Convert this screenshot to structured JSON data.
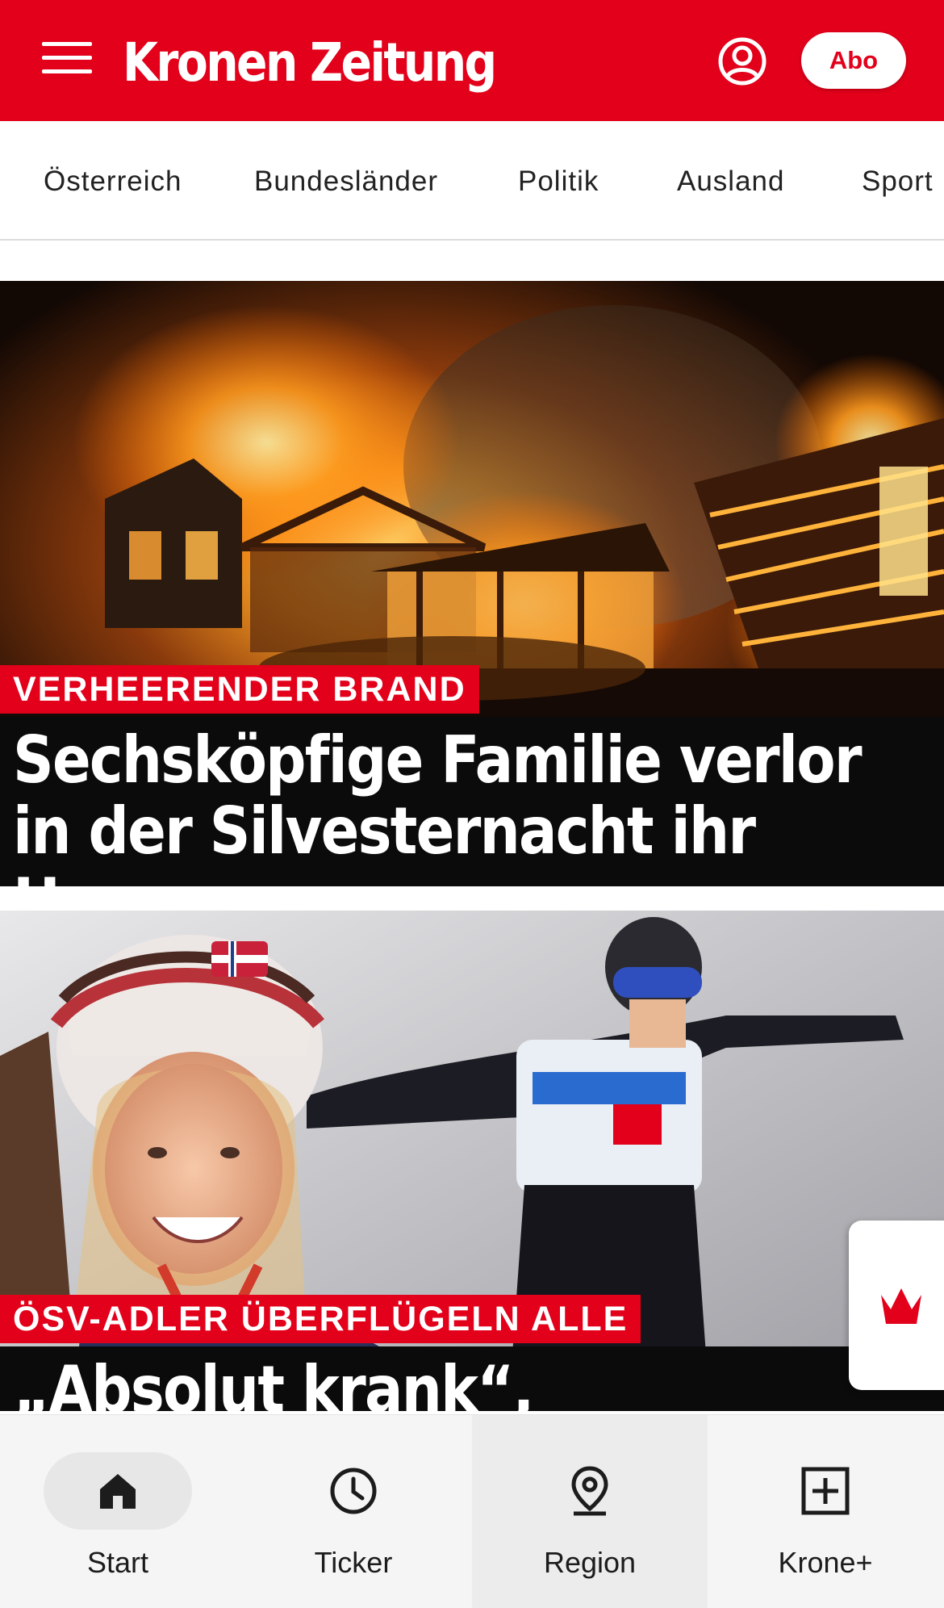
{
  "header": {
    "logo_text": "Kronen Zeitung",
    "abo_label": "Abo",
    "brand_color": "#e2001a"
  },
  "categories": [
    "Österreich",
    "Bundesländer",
    "Politik",
    "Ausland",
    "Sport"
  ],
  "articles": [
    {
      "kicker": "VERHEERENDER BRAND",
      "headline": "Sechsköpfige Familie verlor in der Silvesternacht ihr Haus",
      "image": "burning-house-photo"
    },
    {
      "kicker": "ÖSV-ADLER ÜBERFLÜGELN ALLE",
      "headline": "„Absolut krank“, „verdächtig“:",
      "image": "ski-jumpers-photo"
    }
  ],
  "bottom_nav": [
    {
      "label": "Start",
      "icon": "home-icon",
      "active": true
    },
    {
      "label": "Ticker",
      "icon": "clock-icon",
      "active": false
    },
    {
      "label": "Region",
      "icon": "location-pin-icon",
      "active": false
    },
    {
      "label": "Krone+",
      "icon": "plus-box-icon",
      "active": false
    }
  ]
}
